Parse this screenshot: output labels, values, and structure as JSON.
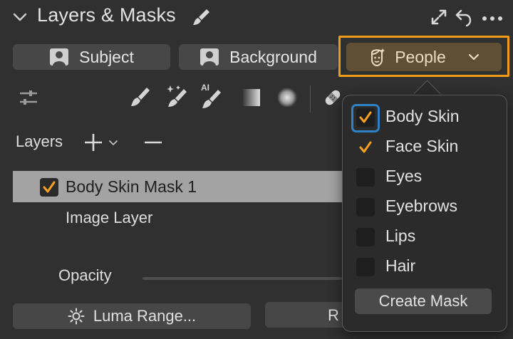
{
  "header": {
    "title": "Layers & Masks",
    "collapse_icon": "chevron-down-icon",
    "brush_icon": "brush-icon",
    "expand_icon": "expand-icon",
    "undo_icon": "undo-icon",
    "more_icon": "more-icon"
  },
  "mask_buttons": {
    "subject": {
      "label": "Subject",
      "icon": "person-icon"
    },
    "background": {
      "label": "Background",
      "icon": "person-icon"
    },
    "people": {
      "label": "People",
      "icon": "face-icon",
      "chevron": "chevron-down-icon"
    }
  },
  "toolbar": {
    "ai_badge": "AI",
    "icons": [
      "adjust-sliders-icon",
      "brush-icon",
      "magic-brush-icon",
      "ai-brush-icon",
      "linear-gradient-icon",
      "radial-gradient-icon",
      "heal-icon"
    ]
  },
  "layers": {
    "label": "Layers",
    "items": [
      {
        "name": "Body Skin Mask 1",
        "checked": true
      },
      {
        "name": "Image Layer"
      }
    ]
  },
  "opacity": {
    "label": "Opacity"
  },
  "bottom_buttons": {
    "luma_range": "Luma Range...",
    "r_partial": "R"
  },
  "people_menu": {
    "options": [
      {
        "label": "Body Skin",
        "checked": true
      },
      {
        "label": "Face Skin",
        "checked": true
      },
      {
        "label": "Eyes",
        "checked": false
      },
      {
        "label": "Eyebrows",
        "checked": false
      },
      {
        "label": "Lips",
        "checked": false
      },
      {
        "label": "Hair",
        "checked": false
      }
    ],
    "create_mask": "Create Mask"
  },
  "colors": {
    "accent_orange": "#f09a1a",
    "check_orange": "#f5a020",
    "focus_blue": "#2e82c8",
    "panel_bg": "#303030"
  }
}
